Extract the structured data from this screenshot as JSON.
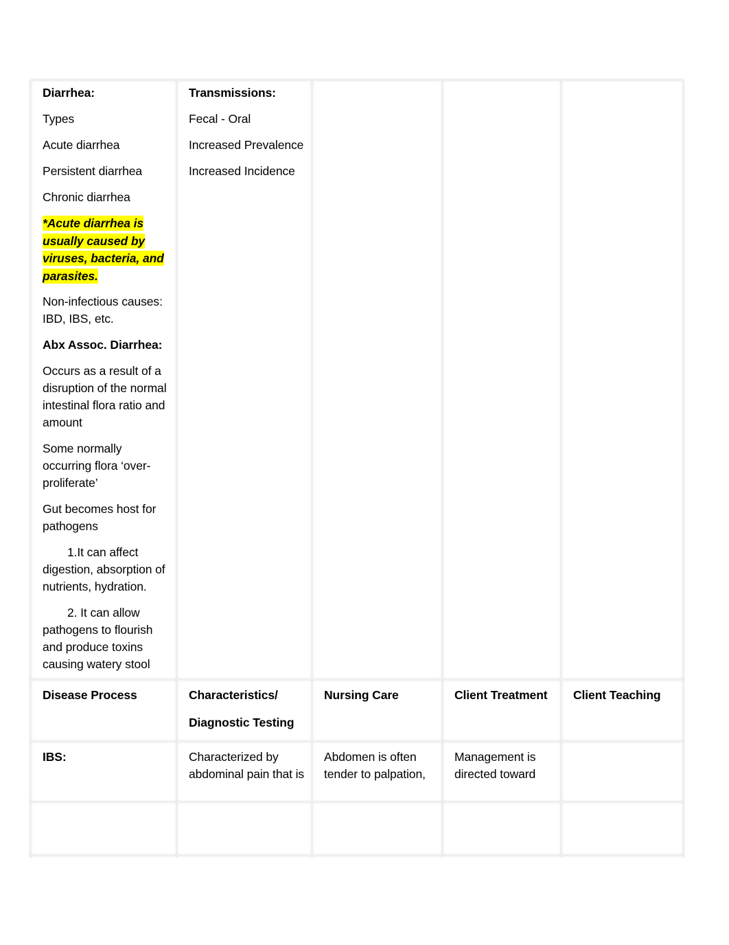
{
  "document": {
    "type": "nursing-study-guide-table",
    "highlight_color": "#ffff00",
    "text_color": "#000000",
    "background_color": "#ffffff",
    "border_color": "#efefef"
  },
  "top_section": {
    "column_1": {
      "heading": "Diarrhea:",
      "items": [
        "Types",
        "Acute diarrhea",
        "Persistent diarrhea",
        "Chronic diarrhea"
      ],
      "highlighted_note": "*Acute diarrhea is usually caused by viruses, bacteria, and parasites.",
      "non_infectious": "Non-infectious causes: IBD, IBS, etc.",
      "subheading": "Abx Assoc. Diarrhea:",
      "paragraphs": [
        "Occurs as a result of a disruption of the normal intestinal flora ratio and amount",
        "Some normally occurring flora ‘over-proliferate’",
        "Gut becomes host for pathogens"
      ],
      "numbered": [
        "1.It can affect digestion, absorption of nutrients, hydration.",
        "2. It can allow pathogens to flourish and produce toxins causing watery stool"
      ]
    },
    "column_2": {
      "heading": "Transmissions:",
      "items": [
        "Fecal - Oral",
        "Increased Prevalence",
        "Increased Incidence"
      ]
    },
    "column_3": {
      "items": []
    },
    "column_4": {
      "items": []
    },
    "column_5": {
      "items": []
    }
  },
  "bottom_table": {
    "headers": [
      "Disease Process",
      "Characteristics/",
      "Nursing Care",
      "Client Treatment",
      "Client Teaching"
    ],
    "header_second_line": "Diagnostic Testing",
    "rows": [
      {
        "disease_process": "IBS:",
        "characteristics": "Characterized by abdominal pain that is",
        "nursing_care": "Abdomen is often tender to palpation,",
        "client_treatment": "Management is directed toward",
        "client_teaching": ""
      }
    ]
  }
}
